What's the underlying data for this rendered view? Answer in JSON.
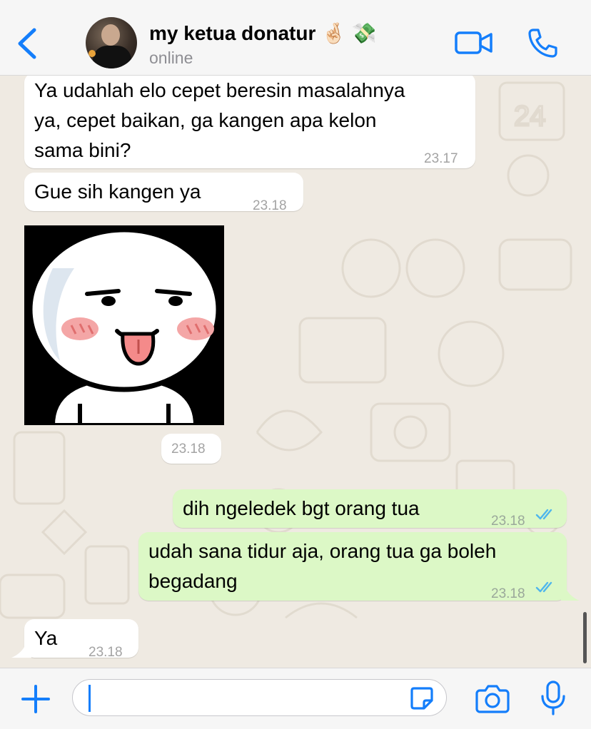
{
  "header": {
    "back_label": "back",
    "contact_name": "my ketua donatur 🤞🏻 💸",
    "status": "online",
    "icons": [
      "chevron-left-icon",
      "video-call-icon",
      "phone-call-icon"
    ]
  },
  "messages": [
    {
      "direction": "in",
      "text_lines": [
        "Ya udahlah elo cepet beresin masalahnya",
        "ya, cepet baikan, ga kangen apa kelon",
        "sama bini?"
      ],
      "time": "23.17"
    },
    {
      "direction": "in",
      "text": "Gue sih kangen ya",
      "time": "23.18"
    },
    {
      "direction": "in",
      "type": "sticker",
      "sticker": "white-face-tongue-out",
      "time": "23.18"
    },
    {
      "direction": "out",
      "text": "dih ngeledek bgt orang tua",
      "time": "23.18",
      "status": "delivered"
    },
    {
      "direction": "out",
      "text_lines": [
        "udah sana tidur aja, orang tua ga boleh",
        "begadang"
      ],
      "time": "23.18",
      "status": "delivered"
    },
    {
      "direction": "in",
      "text": "Ya",
      "time": "23.18"
    }
  ],
  "composer": {
    "value": "",
    "placeholder": "",
    "icons": [
      "plus-icon",
      "sticker-icon",
      "camera-icon",
      "microphone-icon"
    ]
  },
  "colors": {
    "accent": "#147efb",
    "incoming_bubble": "#ffffff",
    "outgoing_bubble": "#dcf8c6",
    "chat_background": "#efeae2",
    "read_ticks": "#4fb6ec"
  }
}
